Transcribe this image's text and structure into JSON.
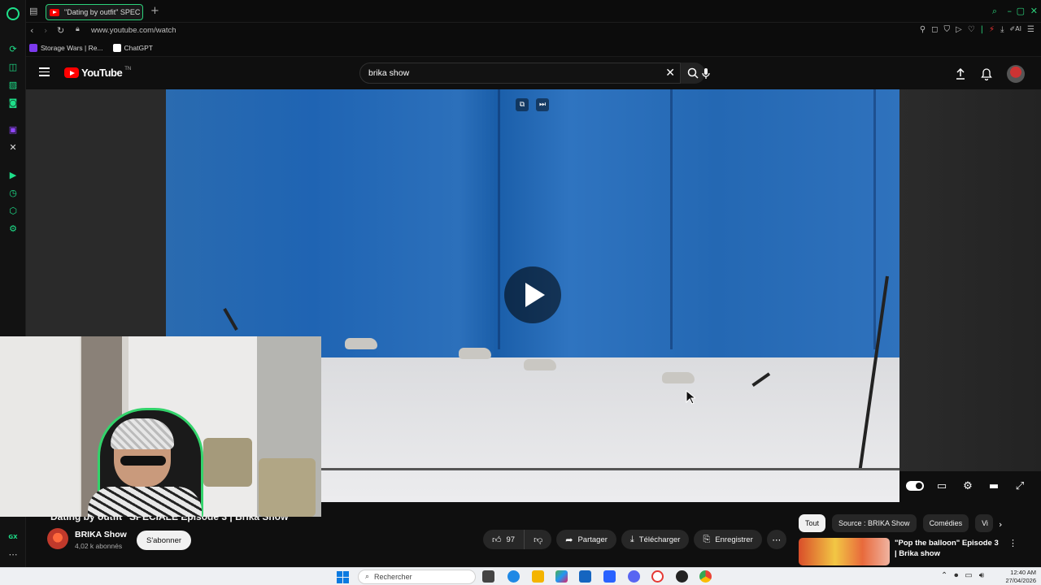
{
  "browser": {
    "tab_title": "\"Dating by outfit\" SPEC",
    "url": "www.youtube.com/watch",
    "ai_label": "AI",
    "bookmarks": [
      {
        "label": "Storage Wars | Re...",
        "color": "#7c3aed"
      },
      {
        "label": "ChatGPT",
        "color": "#ffffff"
      }
    ],
    "sidebar_icons": [
      "history-icon",
      "bag-icon",
      "messenger-icon",
      "music-icon",
      "twitch-icon",
      "x-icon",
      "player-icon",
      "clock-icon",
      "extensions-icon",
      "settings-icon"
    ],
    "gx_label": "GX"
  },
  "masthead": {
    "logo_text": "YouTube",
    "logo_suffix": "TN",
    "search_value": "brika show"
  },
  "video": {
    "title": "Dating by outfit\" SPÉCIALE Episode 3 | Brika Show",
    "channel_name": "BRIKA Show",
    "subscribers": "4,02 k abonnés",
    "subscribe_label": "S'abonner",
    "likes": "97",
    "share_label": "Partager",
    "download_label": "Télécharger",
    "save_label": "Enregistrer",
    "progress": 0
  },
  "sidebar_chips": [
    "Tout",
    "Source : BRIKA Show",
    "Comédies",
    "Vi"
  ],
  "recommendation": {
    "title": "\"Pop the balloon\" Episode 3 | Brika show"
  },
  "taskbar": {
    "search_placeholder": "Rechercher",
    "time": "12:40 AM",
    "date": "27/04/2026"
  },
  "colors": {
    "accent_gx": "#1ee08a",
    "youtube_red": "#ff0000",
    "curtain_blue": "#2467b4"
  }
}
